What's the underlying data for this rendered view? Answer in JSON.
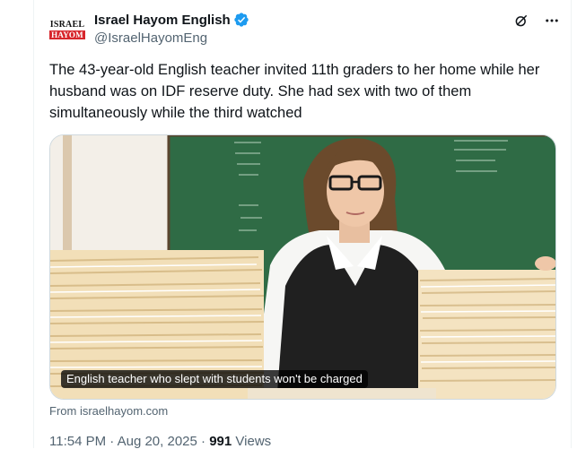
{
  "account": {
    "avatar_line1": "ISRAEL",
    "avatar_line2": "HAYOM",
    "display_name": "Israel Hayom English",
    "handle": "@IsraelHayomEng",
    "verified": true
  },
  "actions": {
    "grok_icon": "grok-icon",
    "more_icon": "more-icon"
  },
  "tweet": {
    "text": "The 43-year-old English teacher invited 11th graders to her home while her husband was on IDF reserve duty. She had sex with two of them simultaneously while the third watched"
  },
  "media": {
    "image_subject": "female teacher with glasses behind stacks of paper files in front of a green chalkboard",
    "caption": "English teacher who slept with students won't be charged",
    "source": "From israelhayom.com"
  },
  "meta": {
    "time": "11:54 PM",
    "sep": " · ",
    "date": "Aug 20, 2025",
    "views_count": "991",
    "views_label": "Views"
  },
  "colors": {
    "verified": "#1d9bf0",
    "secondary": "#536471",
    "primary": "#0f1419",
    "avatar_red": "#d7262c"
  }
}
